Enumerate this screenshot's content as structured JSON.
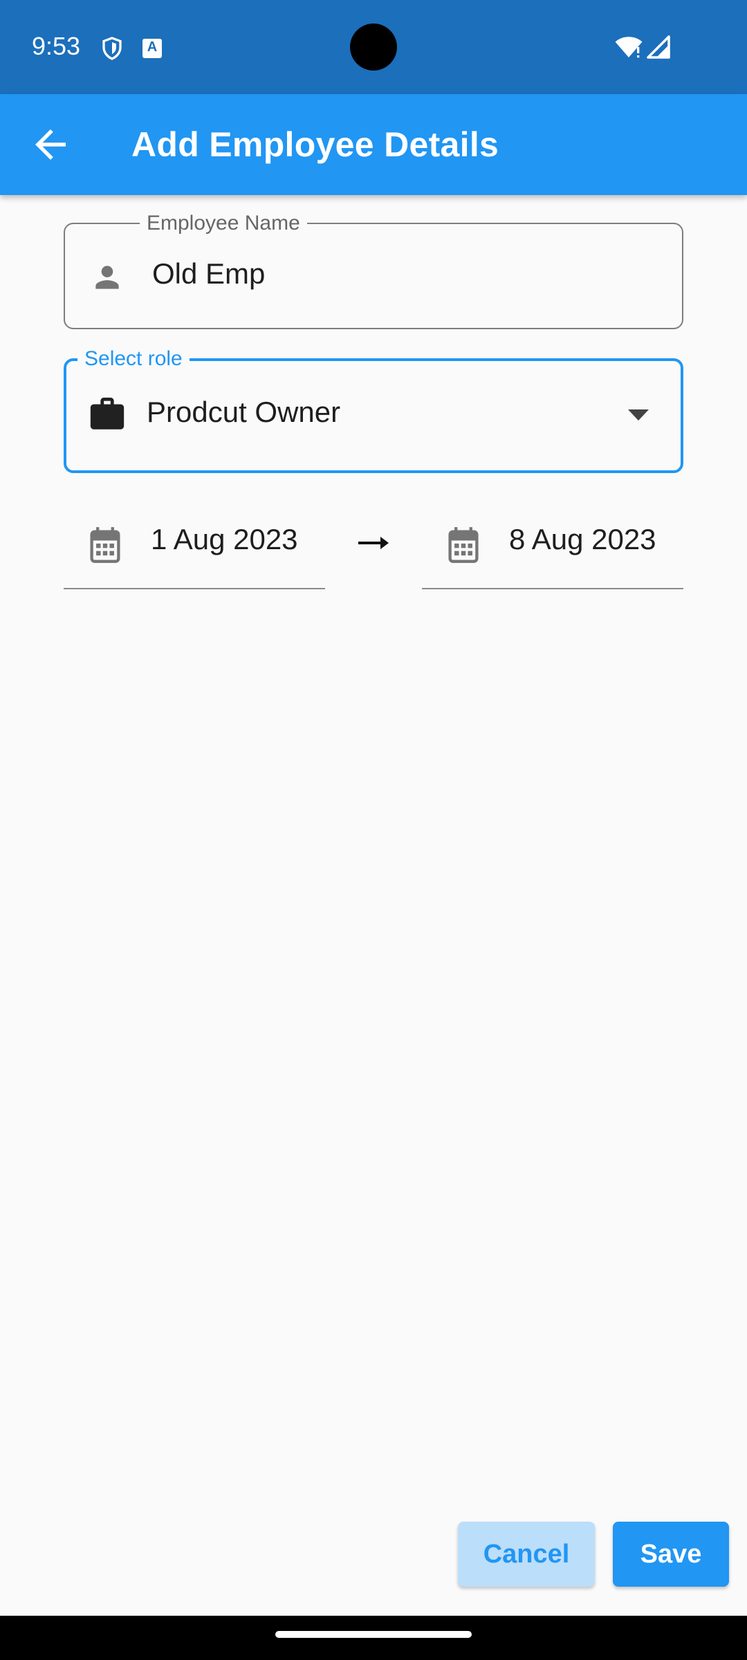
{
  "status_bar": {
    "time": "9:53",
    "icons": [
      "shield-icon",
      "translate-a-icon",
      "wifi-icon",
      "signal-icon"
    ],
    "translate_glyph": "A"
  },
  "app_bar": {
    "title": "Add Employee Details",
    "back_icon": "arrow-back-icon",
    "color": "#2196f3"
  },
  "form": {
    "employee_name": {
      "label": "Employee Name",
      "value": "Old Emp",
      "icon": "person-icon"
    },
    "role": {
      "label": "Select role",
      "value": "Prodcut Owner",
      "icon": "briefcase-icon",
      "focused": true
    },
    "start_date": {
      "value": "1 Aug 2023",
      "icon": "calendar-icon"
    },
    "end_date": {
      "value": "8 Aug 2023",
      "icon": "calendar-icon"
    },
    "separator_icon": "arrow-right-icon"
  },
  "actions": {
    "cancel_label": "Cancel",
    "save_label": "Save"
  },
  "colors": {
    "primary": "#2196f3",
    "primary_light": "#bbdefb",
    "status_bar": "#1c6fbb",
    "background": "#fafafa"
  }
}
